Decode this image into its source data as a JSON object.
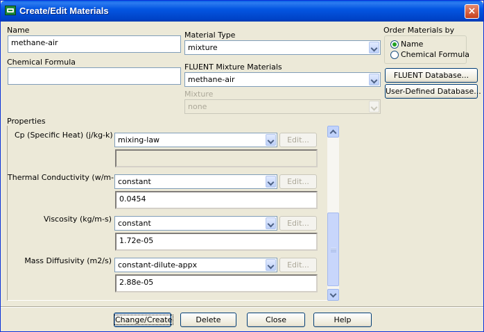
{
  "window": {
    "title": "Create/Edit Materials",
    "close_glyph": "×"
  },
  "name": {
    "label": "Name",
    "value": "methane-air"
  },
  "chemical_formula": {
    "label": "Chemical Formula",
    "value": ""
  },
  "material_type": {
    "label": "Material Type",
    "selected": "mixture"
  },
  "fluent_mixture_materials": {
    "label": "FLUENT Mixture Materials",
    "selected": "methane-air"
  },
  "mixture": {
    "label": "Mixture",
    "selected": "none",
    "disabled": true
  },
  "order_by": {
    "label": "Order Materials by",
    "options": [
      "Name",
      "Chemical Formula"
    ],
    "selected": "Name"
  },
  "side_buttons": {
    "fluent_db": "FLUENT Database...",
    "user_db": "User-Defined Database..."
  },
  "properties": {
    "label": "Properties",
    "items": [
      {
        "label": "Cp (Specific Heat) (j/kg-k)",
        "method": "mixing-law",
        "value": "",
        "edit": "Edit..."
      },
      {
        "label": "Thermal Conductivity (w/m-k)",
        "method": "constant",
        "value": "0.0454",
        "edit": "Edit..."
      },
      {
        "label": "Viscosity (kg/m-s)",
        "method": "constant",
        "value": "1.72e-05",
        "edit": "Edit..."
      },
      {
        "label": "Mass Diffusivity (m2/s)",
        "method": "constant-dilute-appx",
        "value": "2.88e-05",
        "edit": "Edit..."
      }
    ]
  },
  "footer": {
    "change_create": "Change/Create",
    "delete": "Delete",
    "close": "Close",
    "help": "Help"
  },
  "icons": {
    "app": "fluent-app-icon",
    "close": "close-icon",
    "combo": "chevron-down-icon",
    "scroll_up": "scroll-up-icon",
    "scroll_down": "scroll-down-icon"
  },
  "colors": {
    "titlebar": "#0456e2",
    "background": "#ece9d8",
    "field_border": "#7f9db9"
  }
}
